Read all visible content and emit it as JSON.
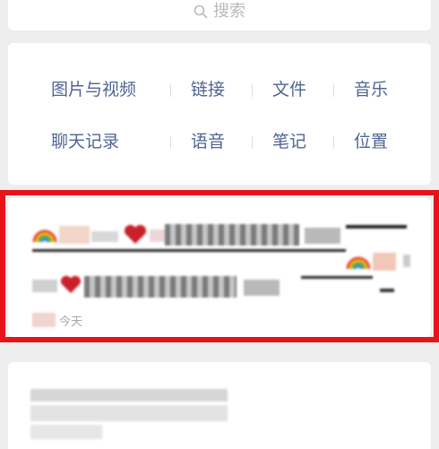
{
  "search": {
    "placeholder": "搜索",
    "icon": "search-icon"
  },
  "categories": {
    "row1": [
      "图片与视频",
      "链接",
      "文件",
      "音乐"
    ],
    "row2": [
      "聊天记录",
      "语音",
      "笔记",
      "位置"
    ]
  },
  "result": {
    "highlight_color": "#e8131a",
    "timestamp": "今天"
  },
  "colors": {
    "category_text": "#4e6593",
    "background": "#eeeeee",
    "card": "#ffffff"
  }
}
